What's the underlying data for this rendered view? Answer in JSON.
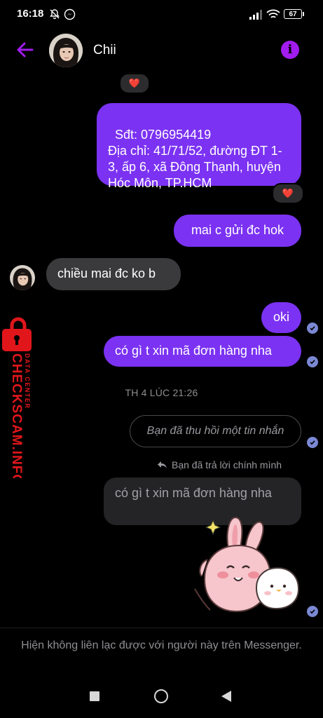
{
  "status_bar": {
    "time": "16:18",
    "battery": "67"
  },
  "header": {
    "contact_name": "Chii",
    "back_icon": "arrow-left-icon",
    "info_icon": "info-icon",
    "accent_color": "#a21cf0"
  },
  "messages": {
    "sent_address": "Sđt: 0796954419\nĐịa chỉ: 41/71/52, đường ĐT 1-3, ấp 6, xã Đông Thạnh, huyện Hóc Môn, TP.HCM",
    "reaction_top": "❤️",
    "reaction_address": "❤️",
    "sent_1": "mai c gửi đc hok",
    "received_1": "chiều mai đc ko b",
    "sent_2": "oki",
    "sent_3": "có gì t xin mã đơn hàng nha",
    "timestamp": "TH 4 LÚC 21:26",
    "unsent_notice": "Bạn đã thu hồi một tin nhắn",
    "reply_label": "Bạn đã trả lời chính mình",
    "quoted_text": "có gì t xin mã đơn hàng nha",
    "sent_bubble_color": "#7b32f2",
    "received_bubble_color": "#3a3a3c"
  },
  "footer": {
    "notice": "Hiện không liên lạc được với người này trên Messenger."
  },
  "watermark": {
    "brand": "CHECKSCAM.INFO",
    "sub": "DATA CENTER",
    "color": "#e0161b"
  },
  "nav": {
    "recents_icon": "square-icon",
    "home_icon": "circle-icon",
    "back_icon": "triangle-back-icon"
  }
}
